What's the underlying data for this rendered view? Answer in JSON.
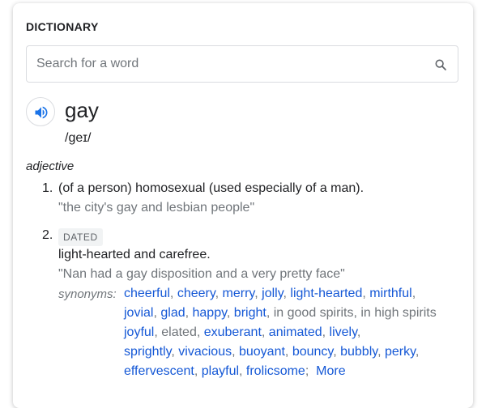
{
  "title": "DICTIONARY",
  "search": {
    "placeholder": "Search for a word",
    "value": ""
  },
  "entry": {
    "word": "gay",
    "phonetic": "/ɡeɪ/",
    "part_of_speech": "adjective",
    "senses": [
      {
        "number": "1.",
        "definition": "(of a person) homosexual (used especially of a man).",
        "example": "\"the city's gay and lesbian people\""
      },
      {
        "number": "2.",
        "label": "DATED",
        "definition": "light-hearted and carefree.",
        "example": "\"Nan had a gay disposition and a very pretty face\"",
        "synonyms_label": "synonyms:",
        "synonyms": [
          "cheerful",
          "cheery",
          "merry",
          "jolly",
          "light-hearted",
          "mirthful",
          "jovial",
          "glad",
          "happy",
          "bright",
          "in good spirits",
          "in high spirits",
          "joyful",
          "elated",
          "exuberant",
          "animated",
          "lively",
          "sprightly",
          "vivacious",
          "buoyant",
          "bouncy",
          "bubbly",
          "perky",
          "effervescent",
          "playful",
          "frolicsome"
        ],
        "more_label": "More"
      }
    ]
  },
  "icons": {
    "search": "search-icon",
    "speaker": "speaker-icon"
  },
  "colors": {
    "link": "#1558d6",
    "muted": "#70757a",
    "text": "#202124"
  }
}
